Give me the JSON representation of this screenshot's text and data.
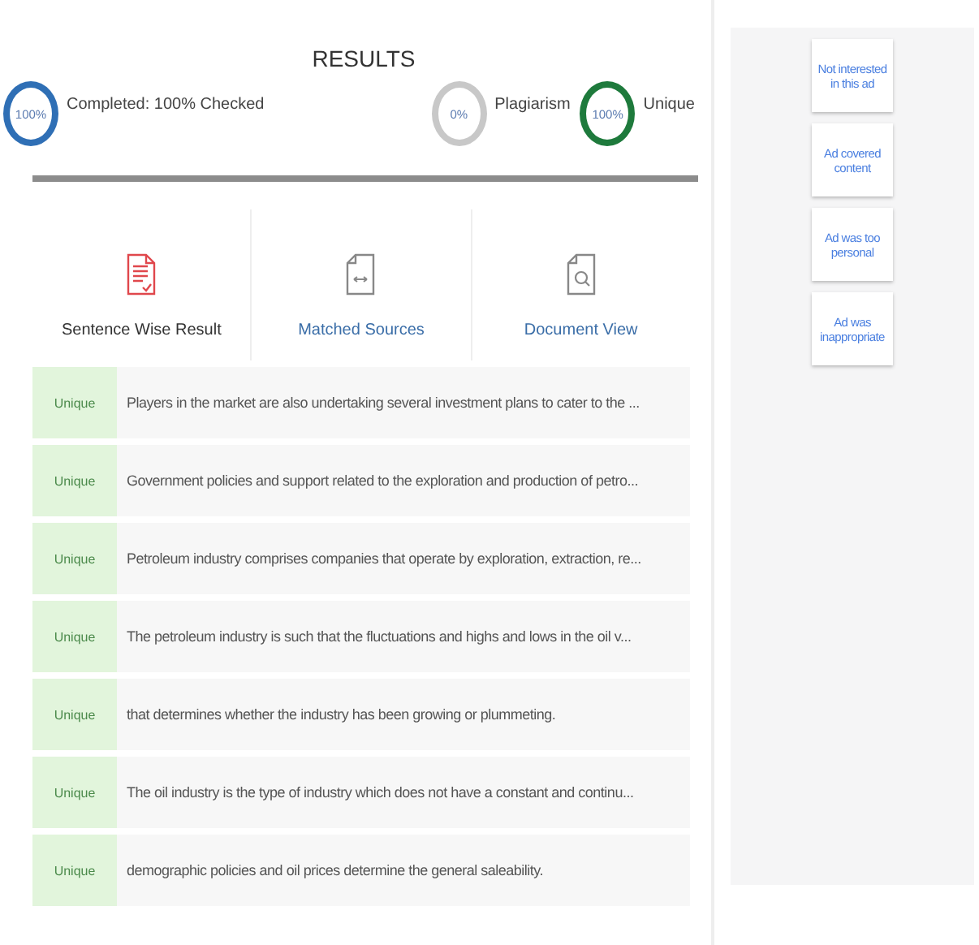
{
  "results": {
    "title": "RESULTS",
    "meters": [
      {
        "kind": "progress",
        "value": "100%",
        "label": "Completed: 100% Checked",
        "color": "#2f6fb5"
      },
      {
        "kind": "score",
        "value": "0%",
        "label": "Plagiarism",
        "color": "#c8c8c8"
      },
      {
        "kind": "score",
        "value": "100%",
        "label": "Unique",
        "color": "#1e7a3c"
      }
    ],
    "tabs": [
      {
        "label": "Sentence Wise Result",
        "kind": "report",
        "selected": true
      },
      {
        "label": "Matched Sources",
        "kind": "compare",
        "selected": false
      },
      {
        "label": "Document View",
        "kind": "search",
        "selected": false
      }
    ],
    "sentences": [
      {
        "status": "Unique",
        "text": "Players in the market are also undertaking several investment plans to cater to the ..."
      },
      {
        "status": "Unique",
        "text": "Government policies and support related to the exploration and production of petro..."
      },
      {
        "status": "Unique",
        "text": "Petroleum industry comprises companies that operate by exploration, extraction, re..."
      },
      {
        "status": "Unique",
        "text": "The petroleum industry is such that the fluctuations and highs and lows in the oil v..."
      },
      {
        "status": "Unique",
        "text": "that determines whether the industry has been growing or plummeting."
      },
      {
        "status": "Unique",
        "text": "The oil industry is the type of industry which does not have a constant and continu..."
      },
      {
        "status": "Unique",
        "text": "demographic policies and oil prices determine the general saleability."
      }
    ]
  },
  "ad_feedback": {
    "options": [
      "Not interested in this ad",
      "Ad covered content",
      "Ad was too personal",
      "Ad was inappropriate"
    ]
  }
}
